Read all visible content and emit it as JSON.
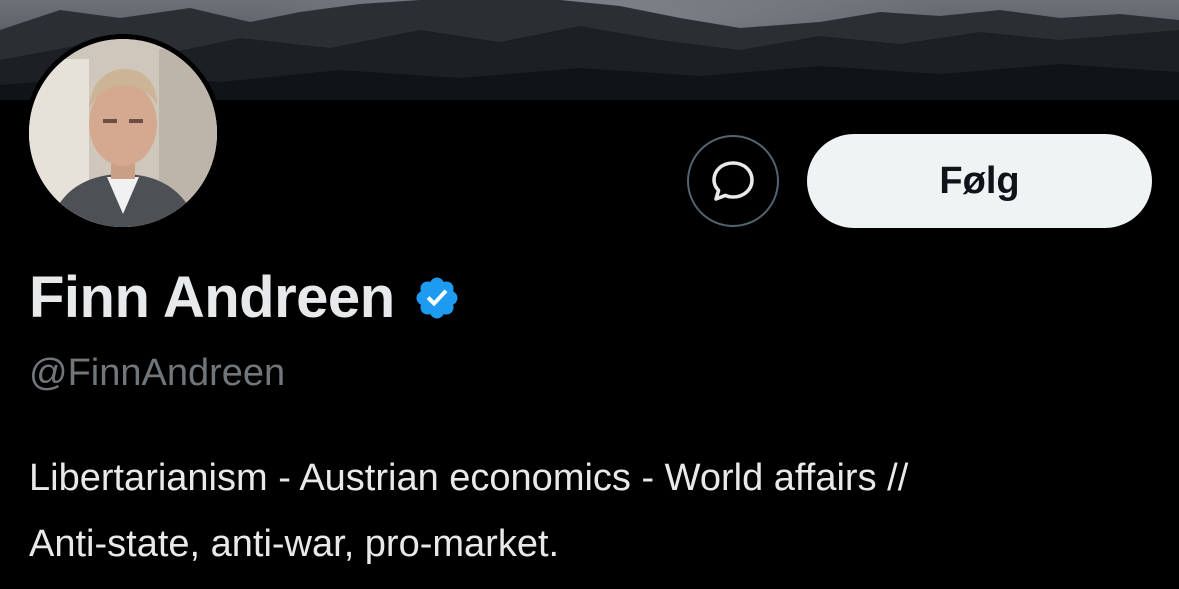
{
  "profile": {
    "display_name": "Finn Andreen",
    "handle": "@FinnAndreen",
    "verified": true,
    "bio_lines": [
      "Libertarianism - Austrian economics - World affairs //",
      "Anti-state, anti-war, pro-market."
    ]
  },
  "actions": {
    "message_icon": "message-bubble-icon",
    "follow_label": "Følg"
  },
  "icons": {
    "verified": "verified-badge-icon"
  },
  "colors": {
    "background": "#000000",
    "primary_text": "#e7e9ea",
    "secondary_text": "#71767b",
    "follow_button_bg": "#eff3f4",
    "follow_button_text": "#0f1419",
    "outline_border": "#536471",
    "verified_blue": "#1d9bf0"
  }
}
